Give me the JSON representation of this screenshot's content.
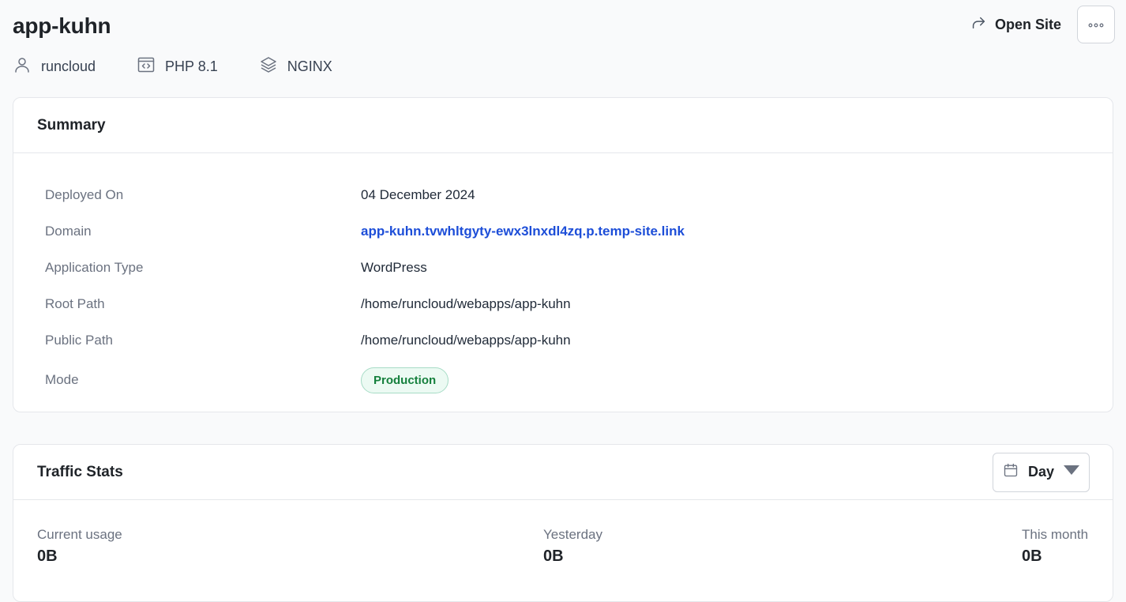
{
  "header": {
    "title": "app-kuhn",
    "open_site_label": "Open Site"
  },
  "meta": {
    "user": "runcloud",
    "php": "PHP 8.1",
    "server": "NGINX"
  },
  "summary": {
    "title": "Summary",
    "rows": [
      {
        "label": "Deployed On",
        "value": "04 December 2024"
      },
      {
        "label": "Domain",
        "value": "app-kuhn.tvwhltgyty-ewx3lnxdl4zq.p.temp-site.link"
      },
      {
        "label": "Application Type",
        "value": "WordPress"
      },
      {
        "label": "Root Path",
        "value": "/home/runcloud/webapps/app-kuhn"
      },
      {
        "label": "Public Path",
        "value": "/home/runcloud/webapps/app-kuhn"
      },
      {
        "label": "Mode",
        "value": "Production"
      }
    ]
  },
  "traffic": {
    "title": "Traffic Stats",
    "period": "Day",
    "stats": [
      {
        "label": "Current usage",
        "value": "0B"
      },
      {
        "label": "Yesterday",
        "value": "0B"
      },
      {
        "label": "This month",
        "value": "0B"
      }
    ]
  },
  "icons": {
    "open_site": "share-arrow-icon",
    "more": "more-dots-icon",
    "user": "user-icon",
    "php": "code-window-icon",
    "server": "layers-icon",
    "calendar": "calendar-icon",
    "dropdown": "caret-down-icon"
  },
  "colors": {
    "link": "#1d4ed8",
    "badge_text": "#15803d",
    "badge_bg": "#ecfaf3"
  }
}
